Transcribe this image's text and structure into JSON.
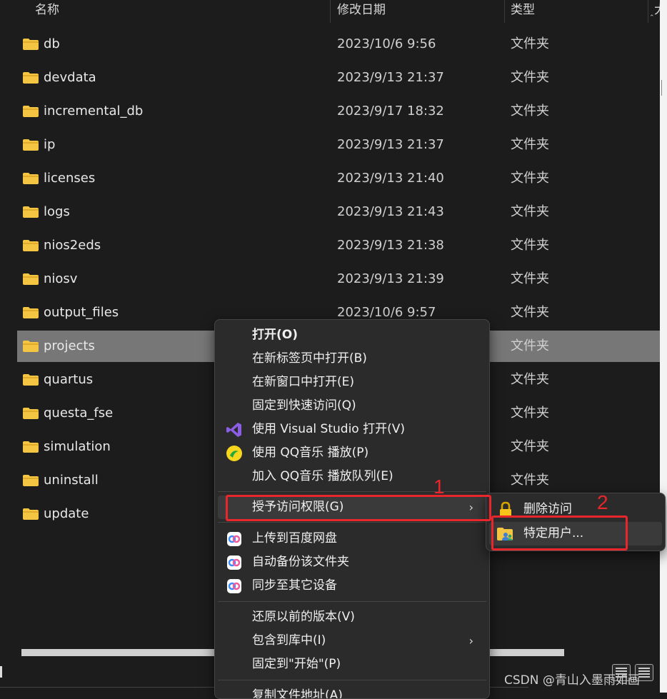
{
  "columns": {
    "name": "名称",
    "modified": "修改日期",
    "type": "类型",
    "size_partial": "大"
  },
  "files": [
    {
      "name": "db",
      "date": "2023/10/6 9:56",
      "type": "文件夹"
    },
    {
      "name": "devdata",
      "date": "2023/9/13 21:37",
      "type": "文件夹"
    },
    {
      "name": "incremental_db",
      "date": "2023/9/17 18:32",
      "type": "文件夹"
    },
    {
      "name": "ip",
      "date": "2023/9/13 21:37",
      "type": "文件夹"
    },
    {
      "name": "licenses",
      "date": "2023/9/13 21:40",
      "type": "文件夹"
    },
    {
      "name": "logs",
      "date": "2023/9/13 21:43",
      "type": "文件夹"
    },
    {
      "name": "nios2eds",
      "date": "2023/9/13 21:38",
      "type": "文件夹"
    },
    {
      "name": "niosv",
      "date": "2023/9/13 21:39",
      "type": "文件夹"
    },
    {
      "name": "output_files",
      "date": "2023/10/6 9:57",
      "type": "文件夹"
    },
    {
      "name": "projects",
      "date": "",
      "type": "文件夹",
      "selected": true
    },
    {
      "name": "quartus",
      "date": "",
      "type": "文件夹"
    },
    {
      "name": "questa_fse",
      "date": "",
      "type": "文件夹"
    },
    {
      "name": "simulation",
      "date": "",
      "type": "文件夹"
    },
    {
      "name": "uninstall",
      "date": "",
      "type": "文件夹"
    },
    {
      "name": "update",
      "date": "",
      "type": ""
    }
  ],
  "context_menu": {
    "open": "打开(O)",
    "open_new_tab": "在新标签页中打开(B)",
    "open_new_window": "在新窗口中打开(E)",
    "pin_quick_access": "固定到快速访问(Q)",
    "open_visual_studio": "使用 Visual Studio 打开(V)",
    "play_qq_music": "使用 QQ音乐 播放(P)",
    "add_qq_queue": "加入 QQ音乐 播放队列(E)",
    "grant_access": "授予访问权限(G)",
    "upload_baidu": "上传到百度网盘",
    "auto_backup": "自动备份该文件夹",
    "sync_devices": "同步至其它设备",
    "restore_versions": "还原以前的版本(V)",
    "include_library": "包含到库中(I)",
    "pin_start": "固定到\"开始\"(P)",
    "copy_path_partial": "复制文件地址(A)"
  },
  "submenu": {
    "remove_access": "删除访问",
    "specific_people": "特定用户..."
  },
  "annotations": {
    "one": "1",
    "two": "2"
  },
  "watermark": "CSDN @青山入墨雨如画",
  "colors": {
    "background": "#1c1c1c",
    "selected_row": "#777777",
    "annotation": "#e8262b",
    "folder": "#f4c542"
  }
}
